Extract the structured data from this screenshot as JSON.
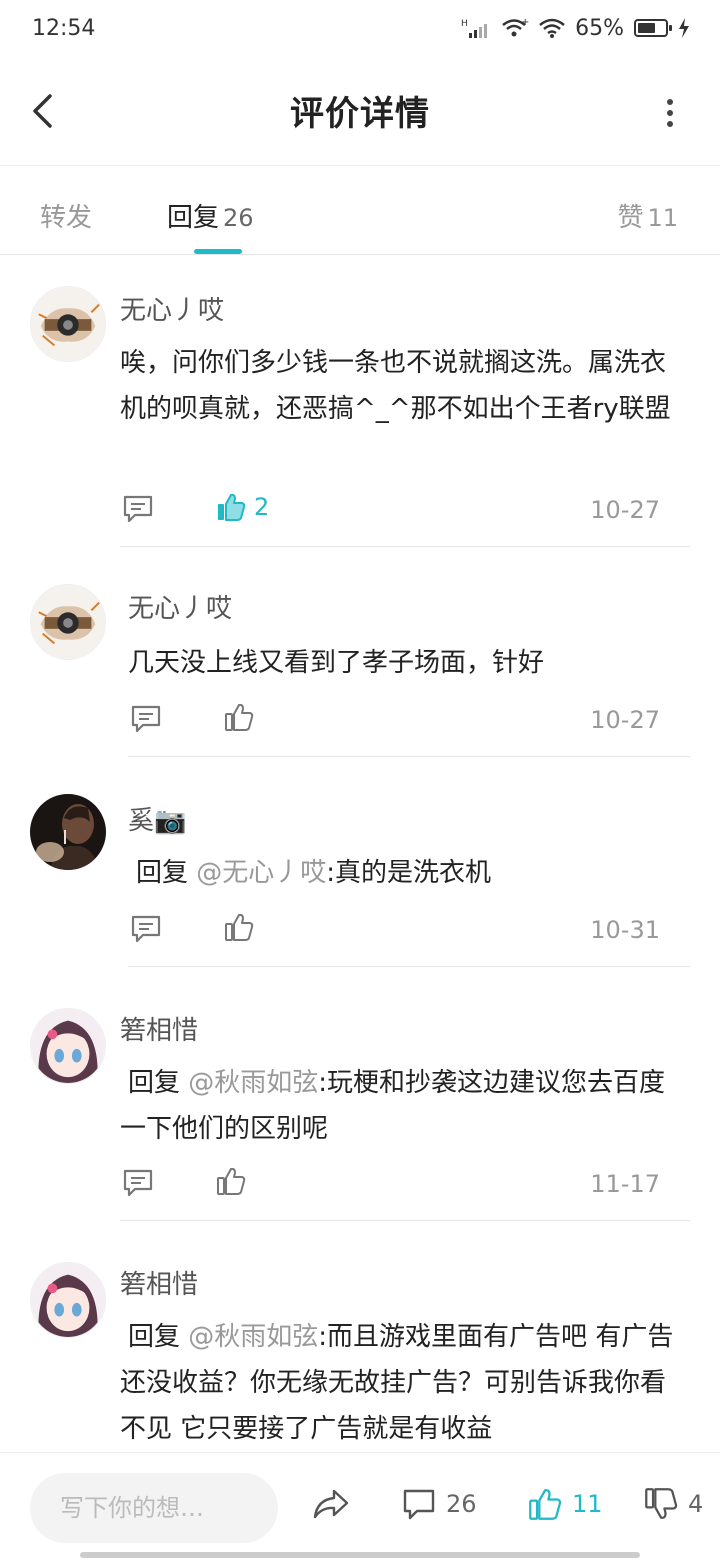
{
  "status_bar": {
    "time": "12:54",
    "battery": "65%",
    "battery_level": 0.65
  },
  "header": {
    "title": "评价详情"
  },
  "tabs": {
    "forward": {
      "label": "转发"
    },
    "reply": {
      "label": "回复",
      "count": "26"
    },
    "like": {
      "label": "赞",
      "count": "11"
    }
  },
  "comments": [
    {
      "user": "无心丿哎",
      "text": "唉，问你们多少钱一条也不说就搁这洗。属洗衣机的呗真就，还恶搞^_^那不如出个王者ry联盟",
      "likes": "2",
      "date": "10-27",
      "liked": true
    },
    {
      "user": "无心丿哎",
      "text": "几天没上线又看到了孝子场面，针好",
      "date": "10-27"
    },
    {
      "user": "奚📷",
      "reply_prefix": "回复",
      "mention": "@无心丿哎",
      "text": ":真的是洗衣机",
      "date": "10-31"
    },
    {
      "user": "箬相惜",
      "reply_prefix": "回复",
      "mention": "@秋雨如弦",
      "text": ":玩梗和抄袭这边建议您去百度一下他们的区别呢",
      "date": "11-17"
    },
    {
      "user": "箬相惜",
      "reply_prefix": "回复",
      "mention": "@秋雨如弦",
      "text": ":而且游戏里面有广告吧 有广告还没收益？你无缘无故挂广告？可别告诉我你看不见 它只要接了广告就是有收益"
    }
  ],
  "bottom_bar": {
    "input_placeholder": "写下你的想…",
    "comment_count": "26",
    "like_count": "11",
    "dislike_count": "4"
  },
  "colors": {
    "accent": "#1fb9c8",
    "text_muted": "#999999"
  }
}
